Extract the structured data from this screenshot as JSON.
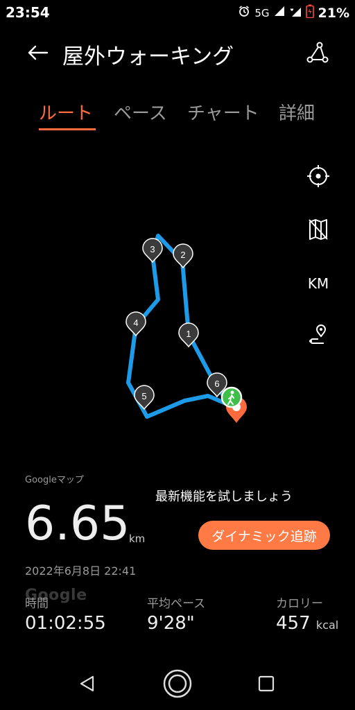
{
  "status": {
    "time": "23:54",
    "network": "5G",
    "battery": "21%"
  },
  "header": {
    "title": "屋外ウォーキング"
  },
  "tabs": [
    {
      "label": "ルート",
      "active": true
    },
    {
      "label": "ペース",
      "active": false
    },
    {
      "label": "チャート",
      "active": false
    },
    {
      "label": "詳細",
      "active": false
    }
  ],
  "tools": {
    "unit_label": "KM"
  },
  "map": {
    "attribution": "Googleマップ",
    "watermark": "Google",
    "markers": [
      "1",
      "2",
      "3",
      "4",
      "5",
      "6"
    ],
    "route_color": "#1e9be8",
    "end_color": "#ff6b3d",
    "start_color": "#3fbf4a"
  },
  "summary": {
    "distance": "6.65",
    "distance_unit": "km",
    "datetime": "2022年6月8日 22:41",
    "promo_text": "最新機能を試しましょう",
    "promo_button": "ダイナミック追跡"
  },
  "stats": [
    {
      "label": "時間",
      "value": "01:02:55",
      "unit": ""
    },
    {
      "label": "平均ペース",
      "value": "9'28\"",
      "unit": ""
    },
    {
      "label": "カロリー",
      "value": "457",
      "unit": "kcal"
    }
  ],
  "colors": {
    "accent": "#ff6b3d",
    "button": "#ff7a45"
  }
}
